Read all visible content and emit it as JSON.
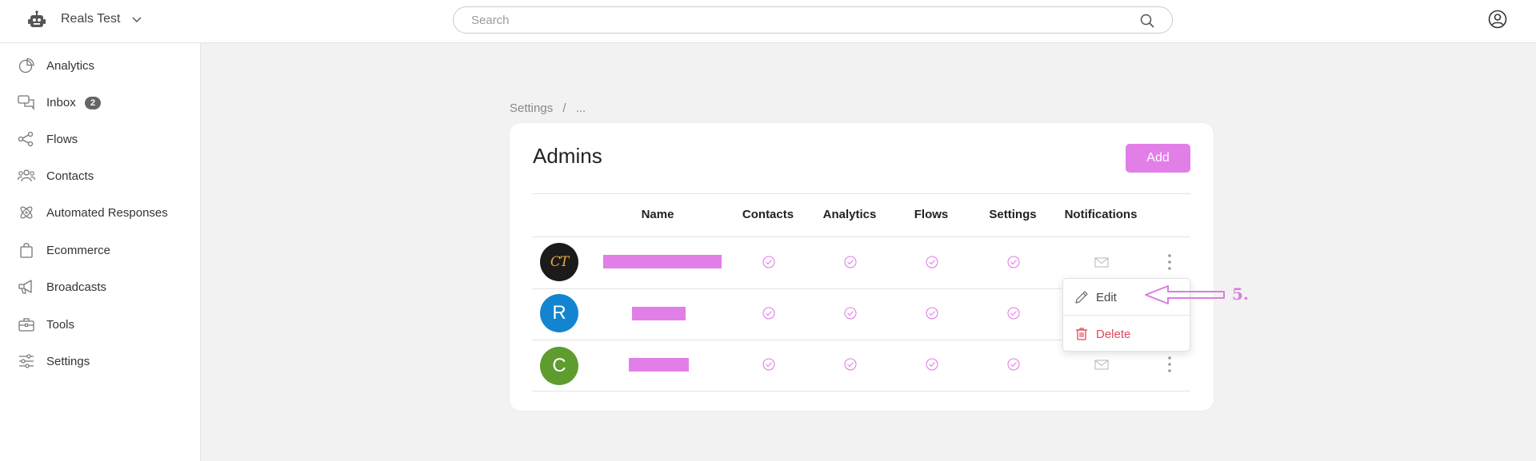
{
  "header": {
    "workspace": "Reals Test",
    "search_placeholder": "Search",
    "bot_icon": "robot-icon",
    "user_icon": "user-circle-icon"
  },
  "sidebar": {
    "items": [
      {
        "label": "Analytics",
        "icon": "pie-chart-icon"
      },
      {
        "label": "Inbox",
        "icon": "chat-bubbles-icon",
        "badge": "2"
      },
      {
        "label": "Flows",
        "icon": "flow-nodes-icon"
      },
      {
        "label": "Contacts",
        "icon": "people-icon"
      },
      {
        "label": "Automated Responses",
        "icon": "atom-icon"
      },
      {
        "label": "Ecommerce",
        "icon": "shopping-bag-icon"
      },
      {
        "label": "Broadcasts",
        "icon": "megaphone-icon"
      },
      {
        "label": "Tools",
        "icon": "toolbox-icon"
      },
      {
        "label": "Settings",
        "icon": "sliders-icon"
      }
    ]
  },
  "breadcrumb": {
    "root": "Settings",
    "separator": "/",
    "current": "..."
  },
  "admins": {
    "title": "Admins",
    "add_label": "Add",
    "columns": [
      "Name",
      "Contacts",
      "Analytics",
      "Flows",
      "Settings",
      "Notifications"
    ],
    "rows": [
      {
        "avatar": "CT",
        "name_redacted": true,
        "contacts": true,
        "analytics": true,
        "flows": true,
        "settings": true,
        "notifications": "mail"
      },
      {
        "avatar": "R",
        "name_redacted": true,
        "contacts": true,
        "analytics": true,
        "flows": true,
        "settings": true,
        "notifications": "mail"
      },
      {
        "avatar": "C",
        "name_redacted": true,
        "contacts": true,
        "analytics": true,
        "flows": true,
        "settings": true,
        "notifications": "mail"
      }
    ]
  },
  "row_menu": {
    "edit_label": "Edit",
    "delete_label": "Delete"
  },
  "annotation": {
    "label": "5."
  },
  "colors": {
    "accent": "#e27ee8",
    "delete": "#e0485a",
    "avatar_r": "#1385d0",
    "avatar_c": "#5e9c2e",
    "avatar_ct": "#1b1b1b"
  }
}
